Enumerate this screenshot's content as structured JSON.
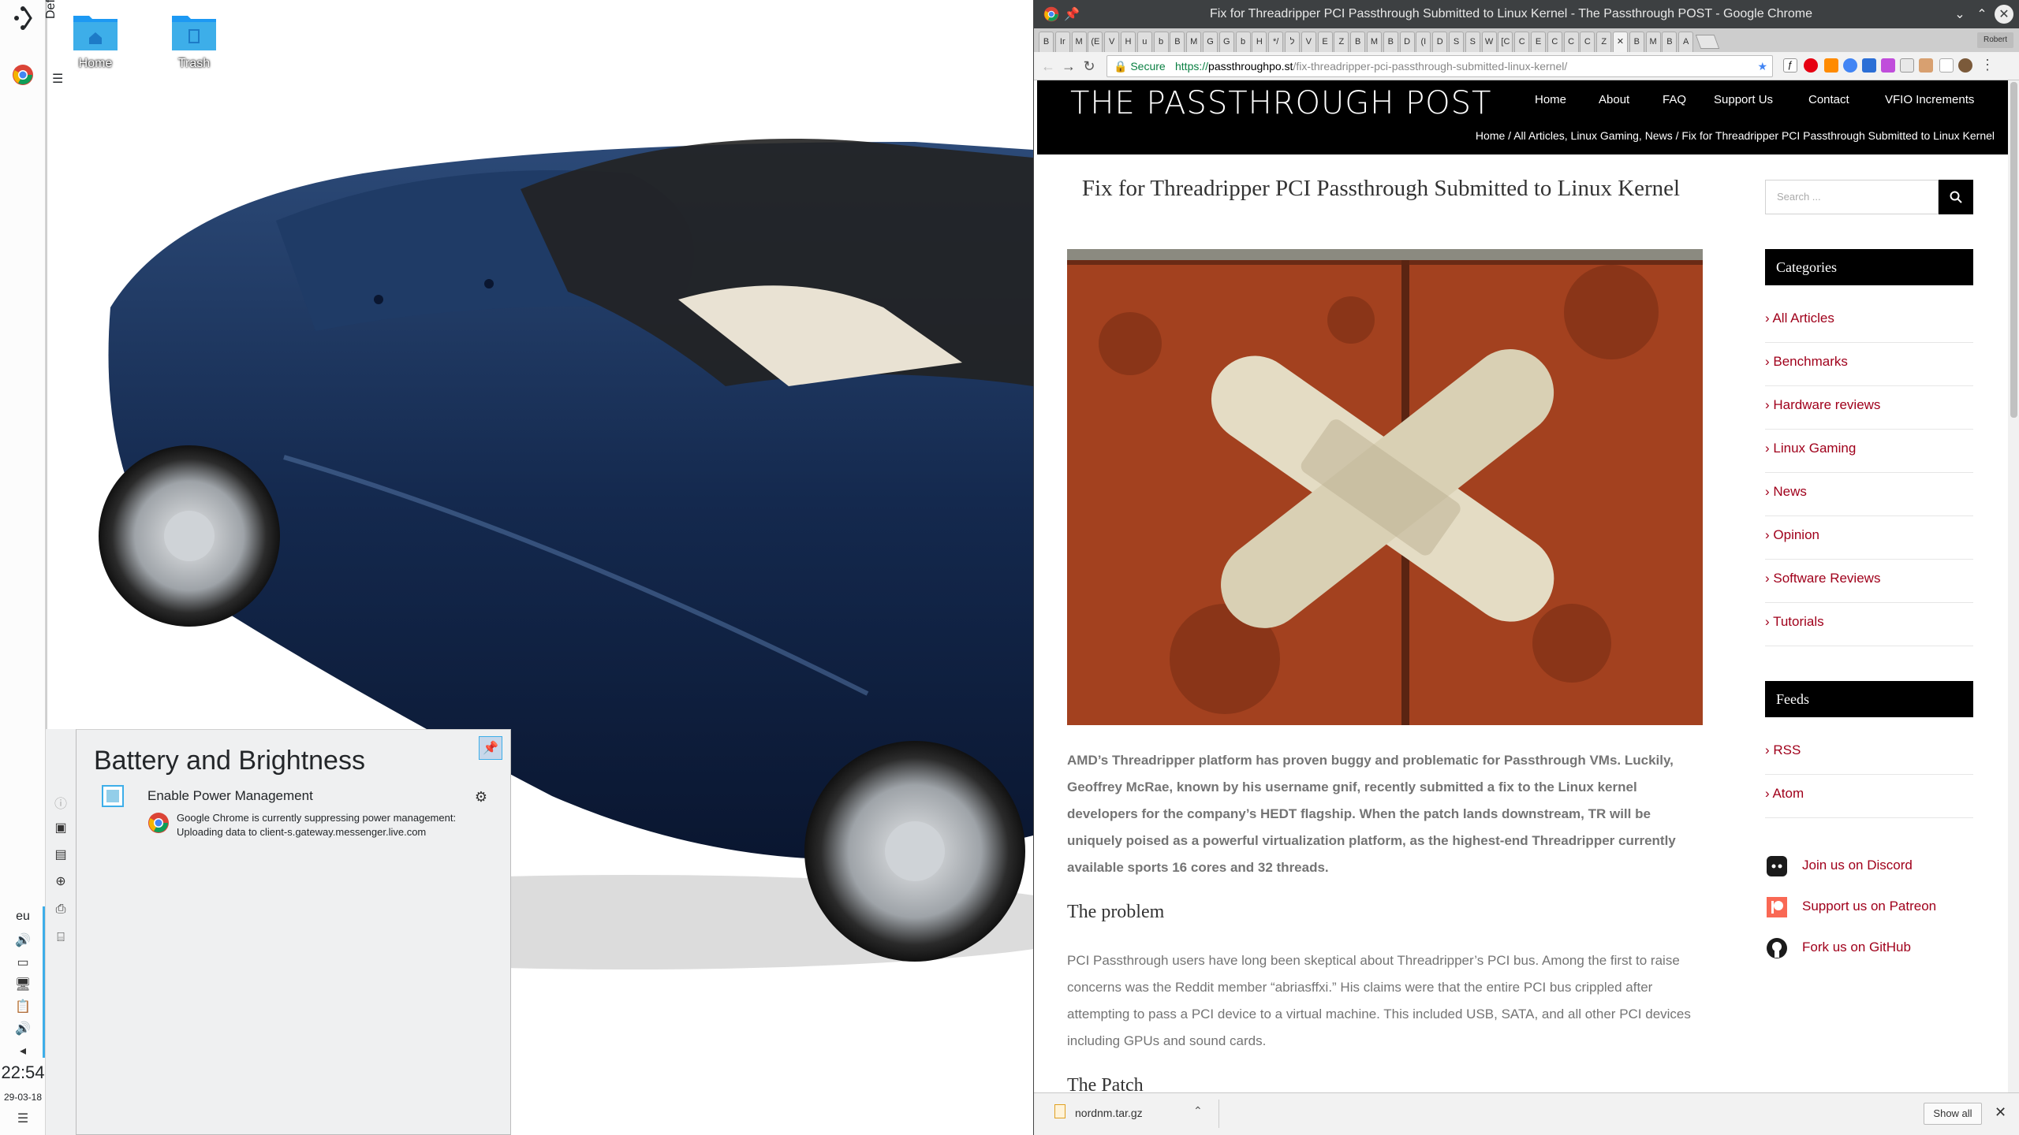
{
  "desktop": {
    "containment_label": "Default",
    "icons": [
      {
        "label": "Home",
        "icon": "folder-home-icon"
      },
      {
        "label": "Trash",
        "icon": "trash-icon"
      }
    ]
  },
  "panel": {
    "keyboard_layout": "eu",
    "clock_time": "22:54",
    "clock_date": "29-03-18"
  },
  "battery_popup": {
    "title": "Battery and Brightness",
    "checkbox_label": "Enable Power Management",
    "inhibit_line1": "Google Chrome is currently suppressing power management:",
    "inhibit_line2": "Uploading data to client-s.gateway.messenger.live.com"
  },
  "chrome": {
    "window_title": "Fix for Threadripper PCI Passthrough Submitted to Linux Kernel - The Passthrough POST - Google Chrome",
    "tabs": [
      "B",
      "Ir",
      "M",
      "(E",
      "V",
      "H",
      "u",
      "b",
      "B",
      "M",
      "G",
      "G",
      "b",
      "H",
      "*/",
      "ל",
      "V",
      "E",
      "Z",
      "B",
      "M",
      "B",
      "D",
      "(I",
      "D",
      "S",
      "S",
      "W",
      "[C",
      "C",
      "E",
      "C",
      "C",
      "C",
      "Z",
      "",
      "B",
      "M",
      "B",
      "A"
    ],
    "secure_label": "Secure",
    "url_scheme": "https://",
    "url_host": "passthroughpo.st",
    "url_path": "/fix-threadripper-pci-passthrough-submitted-linux-kernel/",
    "profile_label": "Robert",
    "download_file": "nordnm.tar.gz",
    "show_all": "Show all"
  },
  "site": {
    "logo": "THE PASSTHROUGH POST",
    "nav": [
      "Home",
      "About",
      "FAQ",
      "Support Us",
      "Contact",
      "VFIO Increments"
    ],
    "breadcrumb": {
      "home": "Home",
      "sep": "/",
      "cats": "All Articles, Linux Gaming, News",
      "current": "Fix for Threadripper PCI Passthrough Submitted to Linux Kernel"
    },
    "article": {
      "title": "Fix for Threadripper PCI Passthrough Submitted to Linux Kernel",
      "intro": "AMD’s Threadripper platform has proven buggy and problematic for Passthrough VMs. Luckily, Geoffrey McRae, known by his username gnif, recently submitted a fix to the Linux kernel developers for the company’s HEDT flagship. When the patch lands downstream, TR will be uniquely poised as a powerful virtualization platform, as the highest-end Threadripper currently available sports 16 cores and 32 threads.",
      "h_problem": "The problem",
      "problem": "PCI Passthrough users have long been skeptical about Threadripper’s PCI bus. Among the first to raise concerns was the Reddit member “abriasffxi.” His claims were that the entire PCI bus crippled after attempting to pass a PCI device to a virtual machine. This included USB, SATA, and all other PCI devices including GPUs and sound cards.",
      "h_patch": "The Patch"
    },
    "sidebar": {
      "search_placeholder": "Search ...",
      "categories_title": "Categories",
      "categories": [
        "All Articles",
        "Benchmarks",
        "Hardware reviews",
        "Linux Gaming",
        "News",
        "Opinion",
        "Software Reviews",
        "Tutorials"
      ],
      "feeds_title": "Feeds",
      "feeds": [
        "RSS",
        "Atom"
      ],
      "social": [
        {
          "label": "Join us on Discord",
          "icon": "discord-icon"
        },
        {
          "label": "Support us on Patreon",
          "icon": "patreon-icon"
        },
        {
          "label": "Fork us on GitHub",
          "icon": "github-icon"
        }
      ]
    }
  },
  "colors": {
    "accent": "#3daee9",
    "link_red": "#a0001b",
    "titlebar": "#3d4042",
    "brick": "#9a3a1c"
  }
}
